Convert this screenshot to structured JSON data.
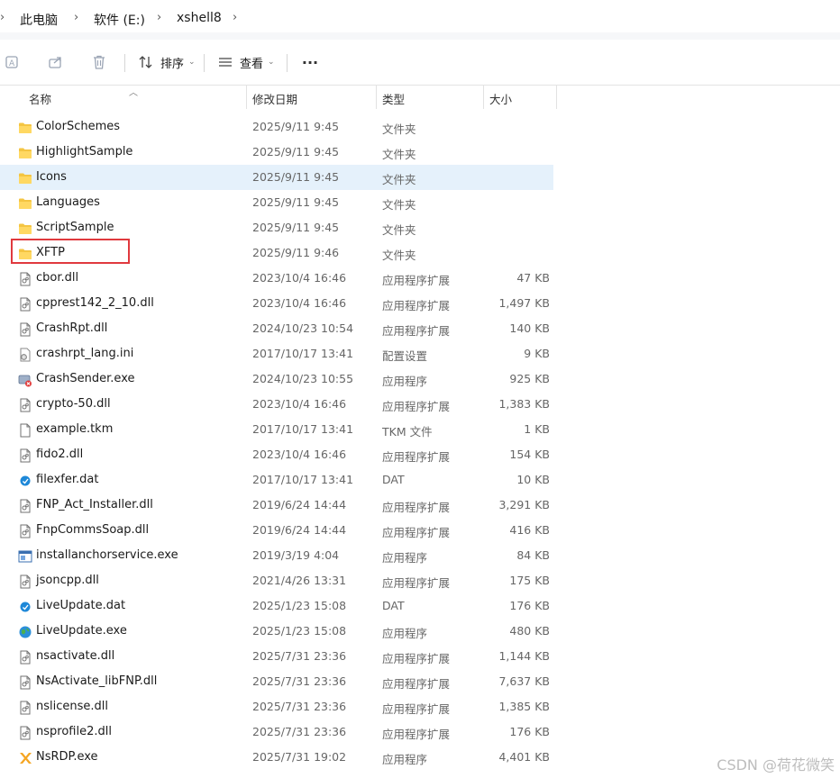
{
  "breadcrumb": {
    "items": [
      "此电脑",
      "软件 (E:)",
      "xshell8"
    ]
  },
  "toolbar": {
    "sort_label": "排序",
    "view_label": "查看",
    "more_label": "···"
  },
  "columns": {
    "name": "名称",
    "date": "修改日期",
    "type": "类型",
    "size": "大小"
  },
  "files": [
    {
      "name": "ColorSchemes",
      "date": "2025/9/11 9:45",
      "type": "文件夹",
      "size": "",
      "icon": "folder"
    },
    {
      "name": "HighlightSample",
      "date": "2025/9/11 9:45",
      "type": "文件夹",
      "size": "",
      "icon": "folder"
    },
    {
      "name": "Icons",
      "date": "2025/9/11 9:45",
      "type": "文件夹",
      "size": "",
      "icon": "folder"
    },
    {
      "name": "Languages",
      "date": "2025/9/11 9:45",
      "type": "文件夹",
      "size": "",
      "icon": "folder"
    },
    {
      "name": "ScriptSample",
      "date": "2025/9/11 9:45",
      "type": "文件夹",
      "size": "",
      "icon": "folder"
    },
    {
      "name": "XFTP",
      "date": "2025/9/11 9:46",
      "type": "文件夹",
      "size": "",
      "icon": "folder"
    },
    {
      "name": "cbor.dll",
      "date": "2023/10/4 16:46",
      "type": "应用程序扩展",
      "size": "47 KB",
      "icon": "dll"
    },
    {
      "name": "cpprest142_2_10.dll",
      "date": "2023/10/4 16:46",
      "type": "应用程序扩展",
      "size": "1,497 KB",
      "icon": "dll"
    },
    {
      "name": "CrashRpt.dll",
      "date": "2024/10/23 10:54",
      "type": "应用程序扩展",
      "size": "140 KB",
      "icon": "dll"
    },
    {
      "name": "crashrpt_lang.ini",
      "date": "2017/10/17 13:41",
      "type": "配置设置",
      "size": "9 KB",
      "icon": "ini"
    },
    {
      "name": "CrashSender.exe",
      "date": "2024/10/23 10:55",
      "type": "应用程序",
      "size": "925 KB",
      "icon": "crash-exe"
    },
    {
      "name": "crypto-50.dll",
      "date": "2023/10/4 16:46",
      "type": "应用程序扩展",
      "size": "1,383 KB",
      "icon": "dll"
    },
    {
      "name": "example.tkm",
      "date": "2017/10/17 13:41",
      "type": "TKM 文件",
      "size": "1 KB",
      "icon": "blank"
    },
    {
      "name": "fido2.dll",
      "date": "2023/10/4 16:46",
      "type": "应用程序扩展",
      "size": "154 KB",
      "icon": "dll"
    },
    {
      "name": "filexfer.dat",
      "date": "2017/10/17 13:41",
      "type": "DAT",
      "size": "10 KB",
      "icon": "dat"
    },
    {
      "name": "FNP_Act_Installer.dll",
      "date": "2019/6/24 14:44",
      "type": "应用程序扩展",
      "size": "3,291 KB",
      "icon": "dll"
    },
    {
      "name": "FnpCommsSoap.dll",
      "date": "2019/6/24 14:44",
      "type": "应用程序扩展",
      "size": "416 KB",
      "icon": "dll"
    },
    {
      "name": "installanchorservice.exe",
      "date": "2019/3/19 4:04",
      "type": "应用程序",
      "size": "84 KB",
      "icon": "exe"
    },
    {
      "name": "jsoncpp.dll",
      "date": "2021/4/26 13:31",
      "type": "应用程序扩展",
      "size": "175 KB",
      "icon": "dll"
    },
    {
      "name": "LiveUpdate.dat",
      "date": "2025/1/23 15:08",
      "type": "DAT",
      "size": "176 KB",
      "icon": "dat"
    },
    {
      "name": "LiveUpdate.exe",
      "date": "2025/1/23 15:08",
      "type": "应用程序",
      "size": "480 KB",
      "icon": "globe"
    },
    {
      "name": "nsactivate.dll",
      "date": "2025/7/31 23:36",
      "type": "应用程序扩展",
      "size": "1,144 KB",
      "icon": "dll"
    },
    {
      "name": "NsActivate_libFNP.dll",
      "date": "2025/7/31 23:36",
      "type": "应用程序扩展",
      "size": "7,637 KB",
      "icon": "dll"
    },
    {
      "name": "nslicense.dll",
      "date": "2025/7/31 23:36",
      "type": "应用程序扩展",
      "size": "1,385 KB",
      "icon": "dll"
    },
    {
      "name": "nsprofile2.dll",
      "date": "2025/7/31 23:36",
      "type": "应用程序扩展",
      "size": "176 KB",
      "icon": "dll"
    },
    {
      "name": "NsRDP.exe",
      "date": "2025/7/31 19:02",
      "type": "应用程序",
      "size": "4,401 KB",
      "icon": "x-logo"
    }
  ],
  "selected_index": 2,
  "watermark": "CSDN @荷花微笑",
  "colors": {
    "folder": "#f4c542",
    "selection": "#e5f1fb",
    "highlight_box": "#e0393e"
  }
}
